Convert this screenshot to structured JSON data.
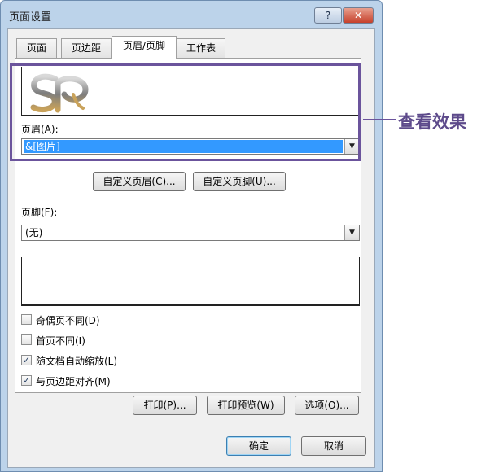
{
  "window": {
    "title": "页面设置",
    "help_label": "?",
    "close_label": "✕"
  },
  "tabs": [
    {
      "label": "页面"
    },
    {
      "label": "页边距"
    },
    {
      "label": "页眉/页脚"
    },
    {
      "label": "工作表"
    }
  ],
  "header": {
    "label": "页眉(A):",
    "value": "&[图片]",
    "custom_button": "自定义页眉(C)...",
    "logo_icon": "sp-logo-image"
  },
  "footer": {
    "label": "页脚(F):",
    "value": "(无)",
    "custom_button": "自定义页脚(U)..."
  },
  "options": [
    {
      "label": "奇偶页不同(D)",
      "checked": false
    },
    {
      "label": "首页不同(I)",
      "checked": false
    },
    {
      "label": "随文档自动缩放(L)",
      "checked": true
    },
    {
      "label": "与页边距对齐(M)",
      "checked": true
    }
  ],
  "actions": {
    "print": "打印(P)...",
    "preview": "打印预览(W)",
    "options": "选项(O)..."
  },
  "dialog_buttons": {
    "ok": "确定",
    "cancel": "取消"
  },
  "callout": {
    "text": "查看效果"
  },
  "colors": {
    "accent_frame": "#6b549c",
    "selection": "#3399ff",
    "window_frame": "#bcd3ea"
  }
}
